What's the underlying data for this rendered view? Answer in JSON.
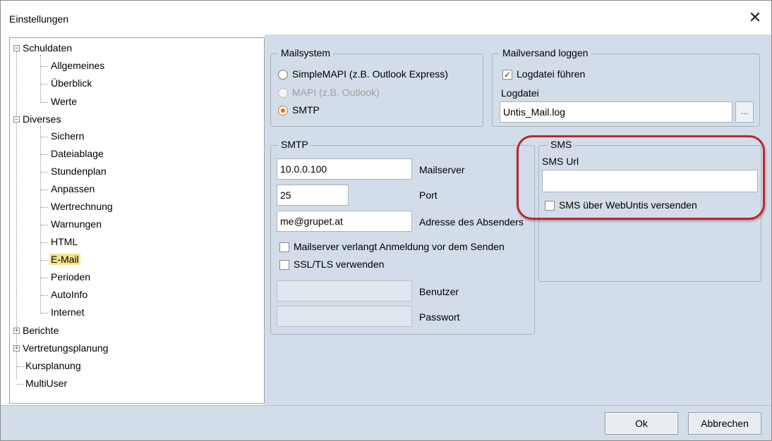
{
  "window": {
    "title": "Einstellungen",
    "close_glyph": "✕"
  },
  "tree": {
    "schuldaten": "Schuldaten",
    "allgemeines": "Allgemeines",
    "ueberblick": "Überblick",
    "werte": "Werte",
    "diverses": "Diverses",
    "sichern": "Sichern",
    "dateiablage": "Dateiablage",
    "stundenplan": "Stundenplan",
    "anpassen": "Anpassen",
    "wertrechnung": "Wertrechnung",
    "warnungen": "Warnungen",
    "html": "HTML",
    "email": "E-Mail",
    "perioden": "Perioden",
    "autoinfo": "AutoInfo",
    "internet": "Internet",
    "berichte": "Berichte",
    "vertretungsplanung": "Vertretungsplanung",
    "kursplanung": "Kursplanung",
    "multiuser": "MultiUser"
  },
  "mailsystem": {
    "label": "Mailsystem",
    "opt1": "SimpleMAPI (z.B. Outlook Express)",
    "opt2": "MAPI (z.B. Outlook)",
    "opt3": "SMTP"
  },
  "maillog": {
    "label": "Mailversand loggen",
    "checkbox": "Logdatei führen",
    "file_label": "Logdatei",
    "file_value": "Untis_Mail.log",
    "browse": "..."
  },
  "smtp": {
    "label": "SMTP",
    "server_value": "10.0.0.100",
    "server_label": "Mailserver",
    "port_value": "25",
    "port_label": "Port",
    "sender_value": "me@grupet.at",
    "sender_label": "Adresse des Absenders",
    "auth_checkbox": "Mailserver verlangt Anmeldung vor dem Senden",
    "ssl_checkbox": "SSL/TLS verwenden",
    "user_label": "Benutzer",
    "password_label": "Passwort"
  },
  "sms": {
    "label": "SMS",
    "url_label": "SMS Url",
    "url_value": "",
    "checkbox": "SMS über WebUntis versenden"
  },
  "buttons": {
    "ok": "Ok",
    "cancel": "Abbrechen"
  },
  "colors": {
    "panel": "#d2dde9",
    "highlight": "#c0252d",
    "selected": "#f8e48c"
  }
}
